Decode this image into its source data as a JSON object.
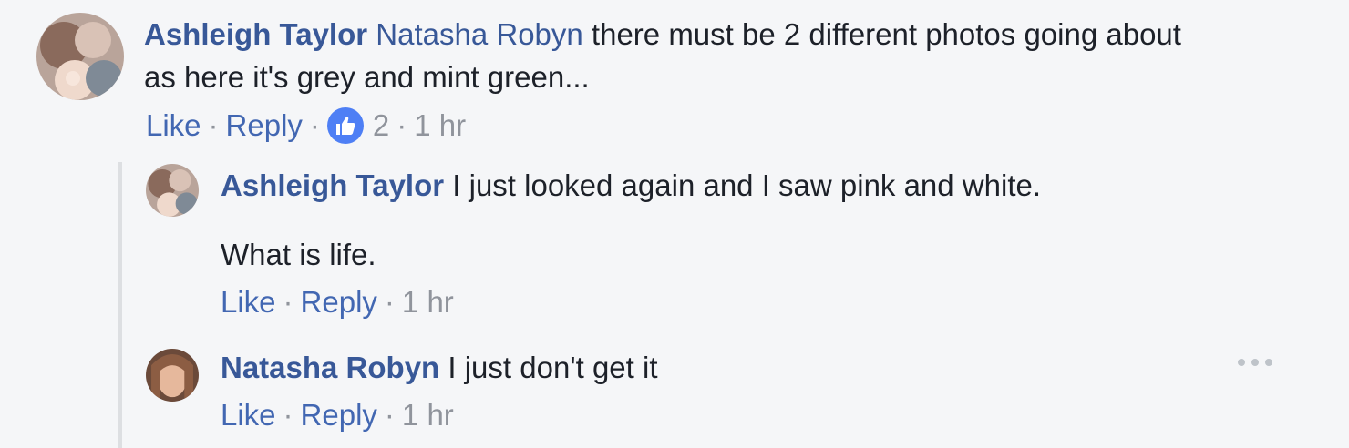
{
  "comment": {
    "author": "Ashleigh Taylor",
    "mention": "Natasha Robyn",
    "text_line1": " there must be 2 different photos going about",
    "text_line2": "as here it's grey and mint green...",
    "like_label": "Like",
    "reply_label": "Reply",
    "reaction_count": "2",
    "time": "1 hr"
  },
  "replies": [
    {
      "author": "Ashleigh Taylor",
      "text": " I just looked again and I saw pink and white.",
      "text_line2": "What is life.",
      "like_label": "Like",
      "reply_label": "Reply",
      "time": "1 hr"
    },
    {
      "author": "Natasha Robyn",
      "text": " I just don't get it",
      "like_label": "Like",
      "reply_label": "Reply",
      "time": "1 hr"
    }
  ],
  "separator": "·",
  "colors": {
    "author": "#385898",
    "link": "#4267b2",
    "meta": "#90949c",
    "like_badge": "#4e7ff5",
    "background": "#f5f6f8"
  },
  "icons": {
    "reaction": "thumbs-up-icon",
    "more": "more-options-icon"
  }
}
